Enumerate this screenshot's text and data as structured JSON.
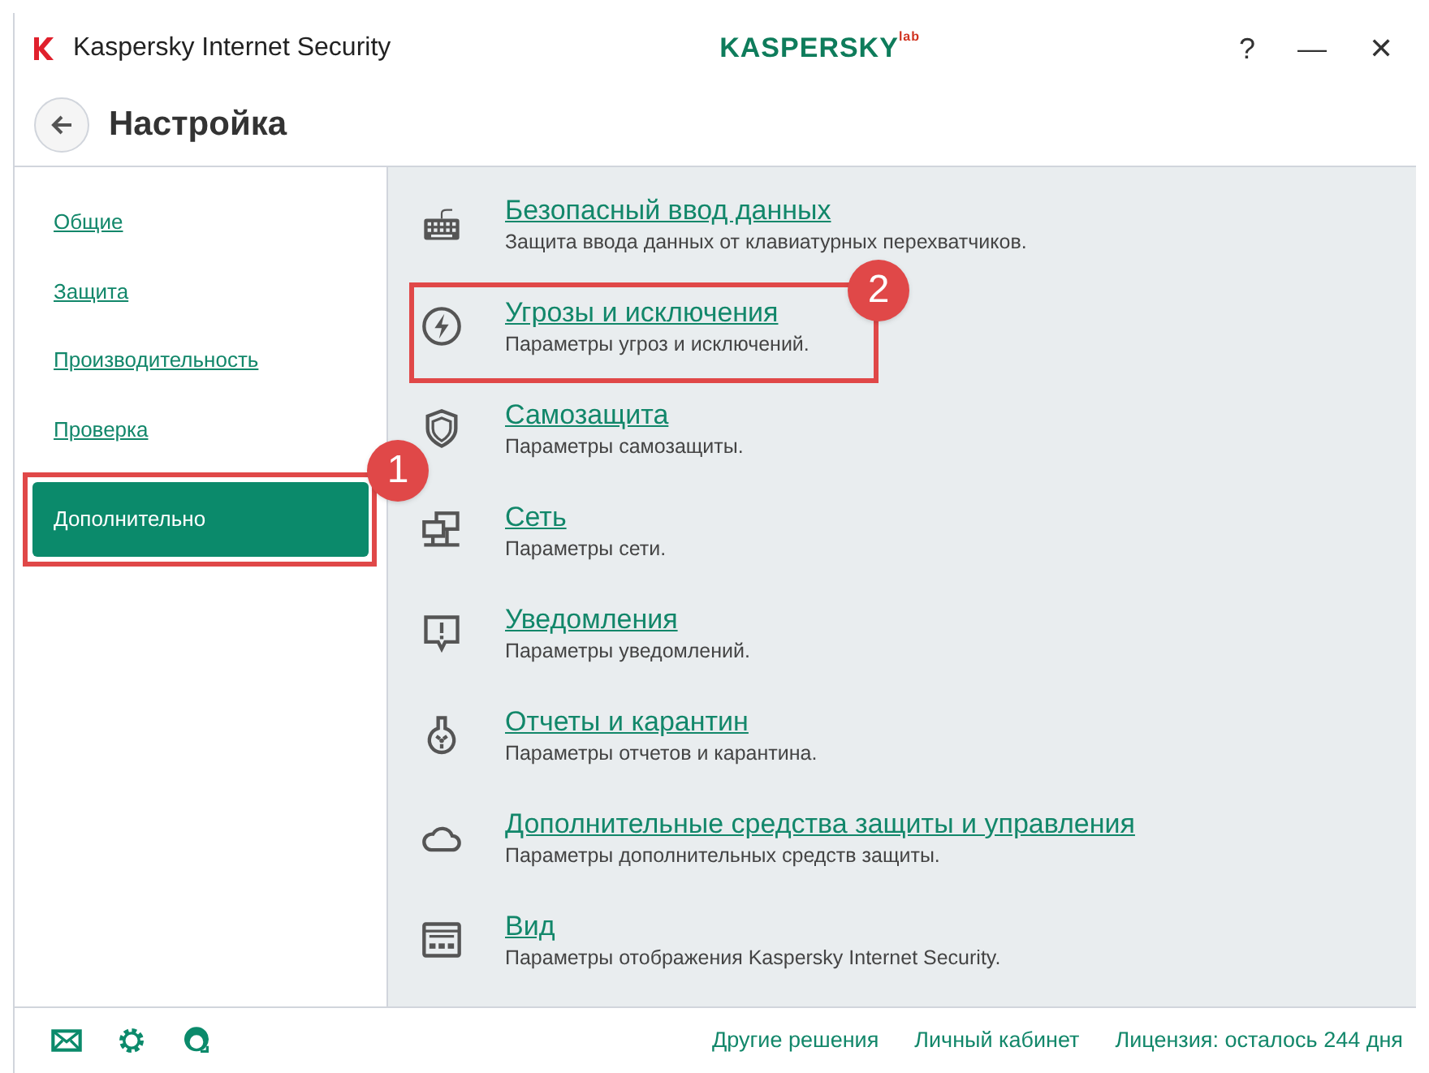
{
  "window": {
    "title": "Kaspersky Internet Security",
    "brand": "KASPERSKY",
    "brand_suffix": "lab",
    "controls": [
      "?",
      "—",
      "✕"
    ]
  },
  "header": {
    "title": "Настройка"
  },
  "sidebar": {
    "items": [
      {
        "label": "Общие",
        "selected": false
      },
      {
        "label": "Защита",
        "selected": false
      },
      {
        "label": "Производительность",
        "selected": false
      },
      {
        "label": "Проверка",
        "selected": false
      },
      {
        "label": "Дополнительно",
        "selected": true,
        "callout": "1"
      }
    ]
  },
  "settings": [
    {
      "kind": "keyboard",
      "title": "Безопасный ввод данных",
      "description": "Защита ввода данных от клавиатурных перехватчиков."
    },
    {
      "kind": "bolt",
      "title": "Угрозы и исключения",
      "description": "Параметры угроз и исключений.",
      "callout": "2"
    },
    {
      "kind": "shield",
      "title": "Самозащита",
      "description": "Параметры самозащиты."
    },
    {
      "kind": "network",
      "title": "Сеть",
      "description": "Параметры сети."
    },
    {
      "kind": "alert",
      "title": "Уведомления",
      "description": "Параметры уведомлений."
    },
    {
      "kind": "flask",
      "title": "Отчеты и карантин",
      "description": "Параметры отчетов и карантина."
    },
    {
      "kind": "cloud",
      "title": "Дополнительные средства защиты и управления",
      "description": "Параметры дополнительных средств защиты."
    },
    {
      "kind": "window",
      "title": "Вид",
      "description": "Параметры отображения Kaspersky Internet Security."
    }
  ],
  "footer": {
    "icons": [
      {
        "kind": "mail"
      },
      {
        "kind": "gear"
      },
      {
        "kind": "support"
      }
    ],
    "links": [
      "Другие решения",
      "Личный кабинет",
      "Лицензия: осталось 244 дня"
    ]
  }
}
